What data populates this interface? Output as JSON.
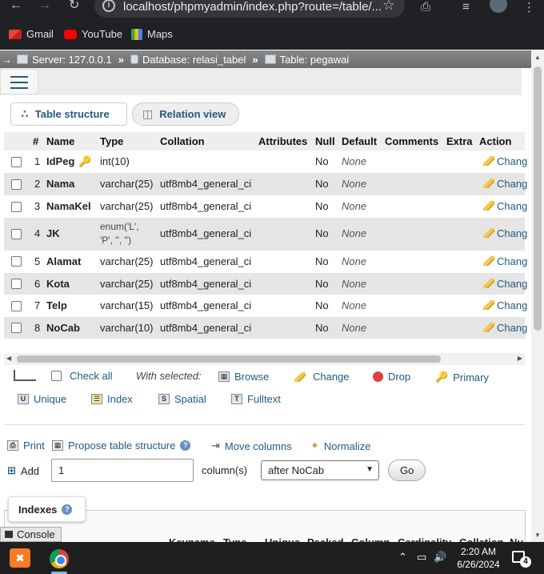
{
  "browser": {
    "url": "localhost/phpmyadmin/index.php?route=/table/...",
    "bookmarks": [
      "Gmail",
      "YouTube",
      "Maps"
    ]
  },
  "breadcrumb": {
    "server": "Server: 127.0.0.1",
    "database": "Database: relasi_tabel",
    "table": "Table: pegawai",
    "separator": "»"
  },
  "tabs": {
    "structure": "Table structure",
    "relation": "Relation view"
  },
  "columns": [
    "#",
    "Name",
    "Type",
    "Collation",
    "Attributes",
    "Null",
    "Default",
    "Comments",
    "Extra",
    "Action"
  ],
  "rows": [
    {
      "num": "1",
      "name": "IdPeg",
      "type": "int(10)",
      "collation": "",
      "null": "No",
      "default": "None",
      "action": "Chang"
    },
    {
      "num": "2",
      "name": "Nama",
      "type": "varchar(25)",
      "collation": "utf8mb4_general_ci",
      "null": "No",
      "default": "None",
      "action": "Chang"
    },
    {
      "num": "3",
      "name": "NamaKel",
      "type": "varchar(25)",
      "collation": "utf8mb4_general_ci",
      "null": "No",
      "default": "None",
      "action": "Chang"
    },
    {
      "num": "4",
      "name": "JK",
      "type_line1": "enum('L',",
      "type_line2": "'P', '', '')",
      "collation": "utf8mb4_general_ci",
      "null": "No",
      "default": "None",
      "action": "Chang"
    },
    {
      "num": "5",
      "name": "Alamat",
      "type": "varchar(25)",
      "collation": "utf8mb4_general_ci",
      "null": "No",
      "default": "None",
      "action": "Chang"
    },
    {
      "num": "6",
      "name": "Kota",
      "type": "varchar(25)",
      "collation": "utf8mb4_general_ci",
      "null": "No",
      "default": "None",
      "action": "Chang"
    },
    {
      "num": "7",
      "name": "Telp",
      "type": "varchar(15)",
      "collation": "utf8mb4_general_ci",
      "null": "No",
      "default": "None",
      "action": "Chang"
    },
    {
      "num": "8",
      "name": "NoCab",
      "type": "varchar(10)",
      "collation": "utf8mb4_general_ci",
      "null": "No",
      "default": "None",
      "action": "Chang"
    }
  ],
  "bulk": {
    "check_all": "Check all",
    "with_selected": "With selected:",
    "browse": "Browse",
    "change": "Change",
    "drop": "Drop",
    "primary": "Primary",
    "unique": "Unique",
    "index": "Index",
    "spatial": "Spatial",
    "fulltext": "Fulltext"
  },
  "tools": {
    "print": "Print",
    "propose": "Propose table structure",
    "move": "Move columns",
    "normalize": "Normalize"
  },
  "add": {
    "label": "Add",
    "count": "1",
    "columns_label": "column(s)",
    "position": "after NoCab",
    "go": "Go"
  },
  "indexes": {
    "title": "Indexes",
    "console": "Console",
    "headers": [
      "Keyname",
      "Type",
      "Unique",
      "Packed",
      "Column",
      "Cardinality",
      "Collation",
      "Nu"
    ]
  },
  "taskbar": {
    "time": "2:20 AM",
    "date": "6/26/2024",
    "notifications": "4"
  }
}
